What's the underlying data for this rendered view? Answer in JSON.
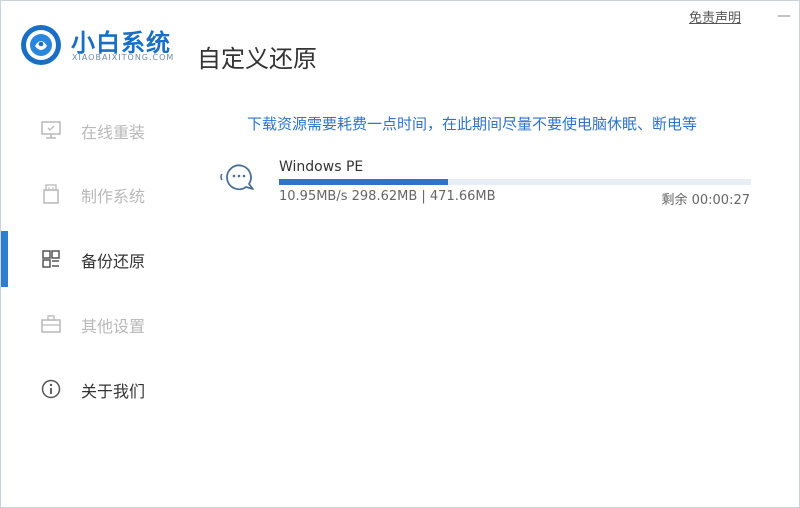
{
  "header": {
    "brand_name": "小白系统",
    "brand_sub": "XIAOBAIXITONG.COM",
    "page_title": "自定义还原",
    "disclaimer": "免责声明",
    "minimize_glyph": "—"
  },
  "sidebar": {
    "items": [
      {
        "label": "在线重装",
        "icon": "monitor-icon"
      },
      {
        "label": "制作系统",
        "icon": "usb-drive-icon"
      },
      {
        "label": "备份还原",
        "icon": "grid-icon",
        "active": true
      },
      {
        "label": "其他设置",
        "icon": "briefcase-icon"
      },
      {
        "label": "关于我们",
        "icon": "info-icon"
      }
    ]
  },
  "download": {
    "notice": "下载资源需要耗费一点时间，在此期间尽量不要使电脑休眠、断电等",
    "name": "Windows PE",
    "progress": 0.357,
    "stats": "10.95MB/s 298.62MB | 471.66MB",
    "remaining": "剩余 00:00:27"
  },
  "colors": {
    "accent": "#2f74c8",
    "brand": "#1a6fc4"
  }
}
